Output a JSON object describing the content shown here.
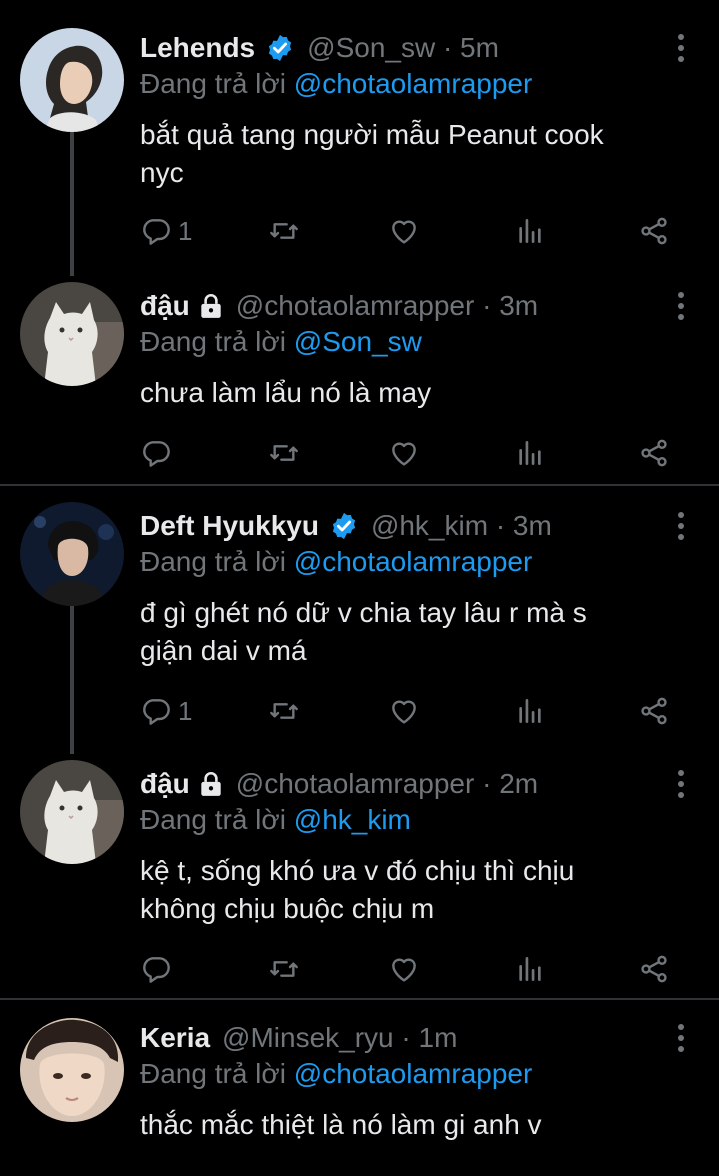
{
  "replying_prefix": "Đang trả lời ",
  "colors": {
    "background": "#000000",
    "text": "#e7e9ea",
    "muted": "#71767b",
    "accent": "#1d9bf0",
    "line": "#3d4145"
  },
  "tweets": [
    {
      "name": "Lehends",
      "verified": true,
      "locked": false,
      "handle_time": "@Son_sw · 5m",
      "replying_to": "@chotaolamrapper",
      "lines": [
        "bắt quả tang người mẫu Peanut cook",
        "nyc"
      ],
      "reply_count": "1",
      "avatar_icon": "avatar-man-icon"
    },
    {
      "name": "đậu",
      "verified": false,
      "locked": true,
      "handle_time": "@chotaolamrapper · 3m",
      "replying_to": "@Son_sw",
      "lines": [
        "chưa làm lẩu nó là may"
      ],
      "reply_count": "",
      "avatar_icon": "avatar-cat-icon"
    },
    {
      "name": "Deft Hyukkyu",
      "verified": true,
      "locked": false,
      "handle_time": "@hk_kim · 3m",
      "replying_to": "@chotaolamrapper",
      "lines": [
        "đ gì ghét nó dữ v chia tay lâu r mà s",
        "giận dai v má"
      ],
      "reply_count": "1",
      "avatar_icon": "avatar-man-icon"
    },
    {
      "name": "đậu",
      "verified": false,
      "locked": true,
      "handle_time": "@chotaolamrapper · 2m",
      "replying_to": "@hk_kim",
      "lines": [
        "kệ t, sống khó ưa v đó chịu thì chịu",
        "không chịu buộc chịu m"
      ],
      "reply_count": "",
      "avatar_icon": "avatar-cat-icon"
    },
    {
      "name": "Keria",
      "verified": false,
      "locked": false,
      "handle_time": "@Minsek_ryu · 1m",
      "replying_to": "@chotaolamrapper",
      "lines": [
        "thắc mắc thiệt là nó làm gi anh v"
      ],
      "reply_count": "",
      "avatar_icon": "avatar-face-icon"
    }
  ]
}
